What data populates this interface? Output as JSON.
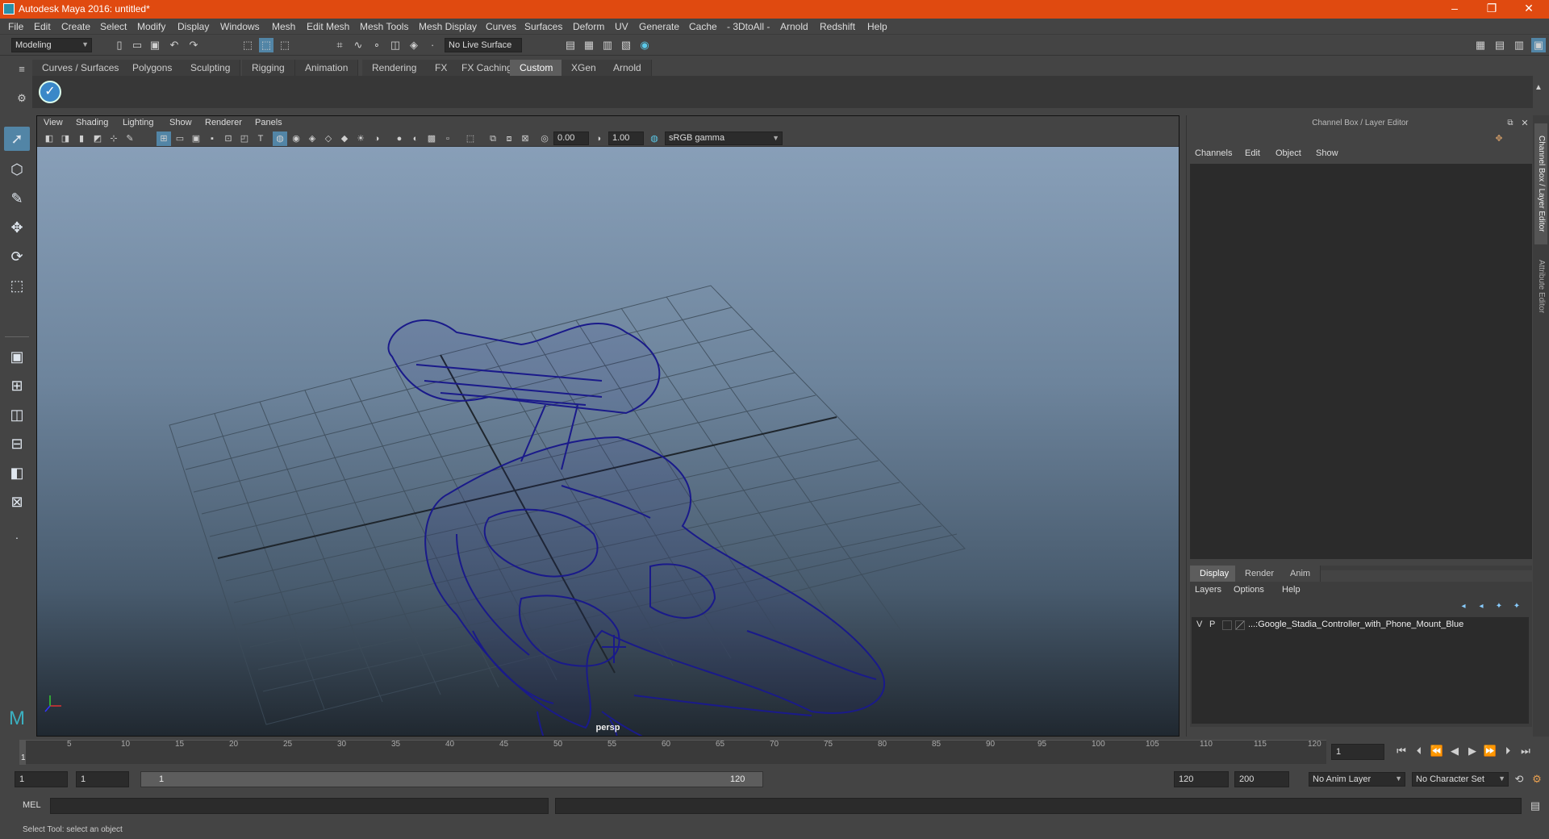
{
  "window": {
    "title": "Autodesk Maya 2016: untitled*",
    "minimize": "–",
    "restore": "❐",
    "close": "✕"
  },
  "menu": [
    "File",
    "Edit",
    "Create",
    "Select",
    "Modify",
    "Display",
    "Windows",
    "Mesh",
    "Edit Mesh",
    "Mesh Tools",
    "Mesh Display",
    "Curves",
    "Surfaces",
    "Deform",
    "UV",
    "Generate",
    "Cache",
    "- 3DtoAll -",
    "Arnold",
    "Redshift",
    "Help"
  ],
  "status": {
    "mode": "Modeling",
    "live_surface": "No Live Surface"
  },
  "shelf_tabs": [
    "Curves / Surfaces",
    "Polygons",
    "Sculpting",
    "Rigging",
    "Animation",
    "Rendering",
    "FX",
    "FX Caching",
    "Custom",
    "XGen",
    "Arnold"
  ],
  "active_shelf": "Custom",
  "viewport": {
    "menu": [
      "View",
      "Shading",
      "Lighting",
      "Show",
      "Renderer",
      "Panels"
    ],
    "exposure": "0.00",
    "gamma": "1.00",
    "color_space": "sRGB gamma",
    "camera_label": "persp",
    "wireframe_color": "#1a1a8a"
  },
  "channel_box": {
    "title": "Channel Box / Layer Editor",
    "menu": [
      "Channels",
      "Edit",
      "Object",
      "Show"
    ]
  },
  "layer_editor": {
    "tabs": [
      "Display",
      "Render",
      "Anim"
    ],
    "active_tab": "Display",
    "menu": [
      "Layers",
      "Options",
      "Help"
    ],
    "layers": [
      {
        "v": "V",
        "p": "P",
        "name": "...:Google_Stadia_Controller_with_Phone_Mount_Blue"
      }
    ]
  },
  "side_tabs": [
    "Channel Box / Layer Editor",
    "Attribute Editor"
  ],
  "timeline": {
    "ticks": [
      "5",
      "10",
      "15",
      "20",
      "25",
      "30",
      "35",
      "40",
      "45",
      "50",
      "55",
      "60",
      "65",
      "70",
      "75",
      "80",
      "85",
      "90",
      "95",
      "100",
      "105",
      "110",
      "115",
      "120"
    ],
    "current_marker": "1",
    "current_frame": "1"
  },
  "range": {
    "start": "1",
    "anim_start": "1",
    "slider_start": "1",
    "slider_end": "120",
    "anim_end": "120",
    "end": "200",
    "anim_layer": "No Anim Layer",
    "character_set": "No Character Set"
  },
  "command": {
    "label": "MEL"
  },
  "help_line": "Select Tool: select an object"
}
